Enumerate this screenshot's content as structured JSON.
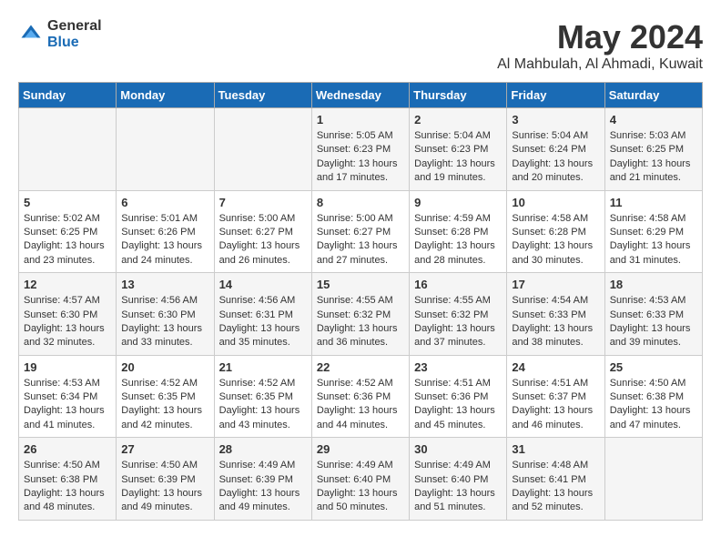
{
  "logo": {
    "general": "General",
    "blue": "Blue"
  },
  "title": "May 2024",
  "location": "Al Mahbulah, Al Ahmadi, Kuwait",
  "days_of_week": [
    "Sunday",
    "Monday",
    "Tuesday",
    "Wednesday",
    "Thursday",
    "Friday",
    "Saturday"
  ],
  "weeks": [
    [
      {
        "day": "",
        "content": ""
      },
      {
        "day": "",
        "content": ""
      },
      {
        "day": "",
        "content": ""
      },
      {
        "day": "1",
        "content": "Sunrise: 5:05 AM\nSunset: 6:23 PM\nDaylight: 13 hours\nand 17 minutes."
      },
      {
        "day": "2",
        "content": "Sunrise: 5:04 AM\nSunset: 6:23 PM\nDaylight: 13 hours\nand 19 minutes."
      },
      {
        "day": "3",
        "content": "Sunrise: 5:04 AM\nSunset: 6:24 PM\nDaylight: 13 hours\nand 20 minutes."
      },
      {
        "day": "4",
        "content": "Sunrise: 5:03 AM\nSunset: 6:25 PM\nDaylight: 13 hours\nand 21 minutes."
      }
    ],
    [
      {
        "day": "5",
        "content": "Sunrise: 5:02 AM\nSunset: 6:25 PM\nDaylight: 13 hours\nand 23 minutes."
      },
      {
        "day": "6",
        "content": "Sunrise: 5:01 AM\nSunset: 6:26 PM\nDaylight: 13 hours\nand 24 minutes."
      },
      {
        "day": "7",
        "content": "Sunrise: 5:00 AM\nSunset: 6:27 PM\nDaylight: 13 hours\nand 26 minutes."
      },
      {
        "day": "8",
        "content": "Sunrise: 5:00 AM\nSunset: 6:27 PM\nDaylight: 13 hours\nand 27 minutes."
      },
      {
        "day": "9",
        "content": "Sunrise: 4:59 AM\nSunset: 6:28 PM\nDaylight: 13 hours\nand 28 minutes."
      },
      {
        "day": "10",
        "content": "Sunrise: 4:58 AM\nSunset: 6:28 PM\nDaylight: 13 hours\nand 30 minutes."
      },
      {
        "day": "11",
        "content": "Sunrise: 4:58 AM\nSunset: 6:29 PM\nDaylight: 13 hours\nand 31 minutes."
      }
    ],
    [
      {
        "day": "12",
        "content": "Sunrise: 4:57 AM\nSunset: 6:30 PM\nDaylight: 13 hours\nand 32 minutes."
      },
      {
        "day": "13",
        "content": "Sunrise: 4:56 AM\nSunset: 6:30 PM\nDaylight: 13 hours\nand 33 minutes."
      },
      {
        "day": "14",
        "content": "Sunrise: 4:56 AM\nSunset: 6:31 PM\nDaylight: 13 hours\nand 35 minutes."
      },
      {
        "day": "15",
        "content": "Sunrise: 4:55 AM\nSunset: 6:32 PM\nDaylight: 13 hours\nand 36 minutes."
      },
      {
        "day": "16",
        "content": "Sunrise: 4:55 AM\nSunset: 6:32 PM\nDaylight: 13 hours\nand 37 minutes."
      },
      {
        "day": "17",
        "content": "Sunrise: 4:54 AM\nSunset: 6:33 PM\nDaylight: 13 hours\nand 38 minutes."
      },
      {
        "day": "18",
        "content": "Sunrise: 4:53 AM\nSunset: 6:33 PM\nDaylight: 13 hours\nand 39 minutes."
      }
    ],
    [
      {
        "day": "19",
        "content": "Sunrise: 4:53 AM\nSunset: 6:34 PM\nDaylight: 13 hours\nand 41 minutes."
      },
      {
        "day": "20",
        "content": "Sunrise: 4:52 AM\nSunset: 6:35 PM\nDaylight: 13 hours\nand 42 minutes."
      },
      {
        "day": "21",
        "content": "Sunrise: 4:52 AM\nSunset: 6:35 PM\nDaylight: 13 hours\nand 43 minutes."
      },
      {
        "day": "22",
        "content": "Sunrise: 4:52 AM\nSunset: 6:36 PM\nDaylight: 13 hours\nand 44 minutes."
      },
      {
        "day": "23",
        "content": "Sunrise: 4:51 AM\nSunset: 6:36 PM\nDaylight: 13 hours\nand 45 minutes."
      },
      {
        "day": "24",
        "content": "Sunrise: 4:51 AM\nSunset: 6:37 PM\nDaylight: 13 hours\nand 46 minutes."
      },
      {
        "day": "25",
        "content": "Sunrise: 4:50 AM\nSunset: 6:38 PM\nDaylight: 13 hours\nand 47 minutes."
      }
    ],
    [
      {
        "day": "26",
        "content": "Sunrise: 4:50 AM\nSunset: 6:38 PM\nDaylight: 13 hours\nand 48 minutes."
      },
      {
        "day": "27",
        "content": "Sunrise: 4:50 AM\nSunset: 6:39 PM\nDaylight: 13 hours\nand 49 minutes."
      },
      {
        "day": "28",
        "content": "Sunrise: 4:49 AM\nSunset: 6:39 PM\nDaylight: 13 hours\nand 49 minutes."
      },
      {
        "day": "29",
        "content": "Sunrise: 4:49 AM\nSunset: 6:40 PM\nDaylight: 13 hours\nand 50 minutes."
      },
      {
        "day": "30",
        "content": "Sunrise: 4:49 AM\nSunset: 6:40 PM\nDaylight: 13 hours\nand 51 minutes."
      },
      {
        "day": "31",
        "content": "Sunrise: 4:48 AM\nSunset: 6:41 PM\nDaylight: 13 hours\nand 52 minutes."
      },
      {
        "day": "",
        "content": ""
      }
    ]
  ]
}
